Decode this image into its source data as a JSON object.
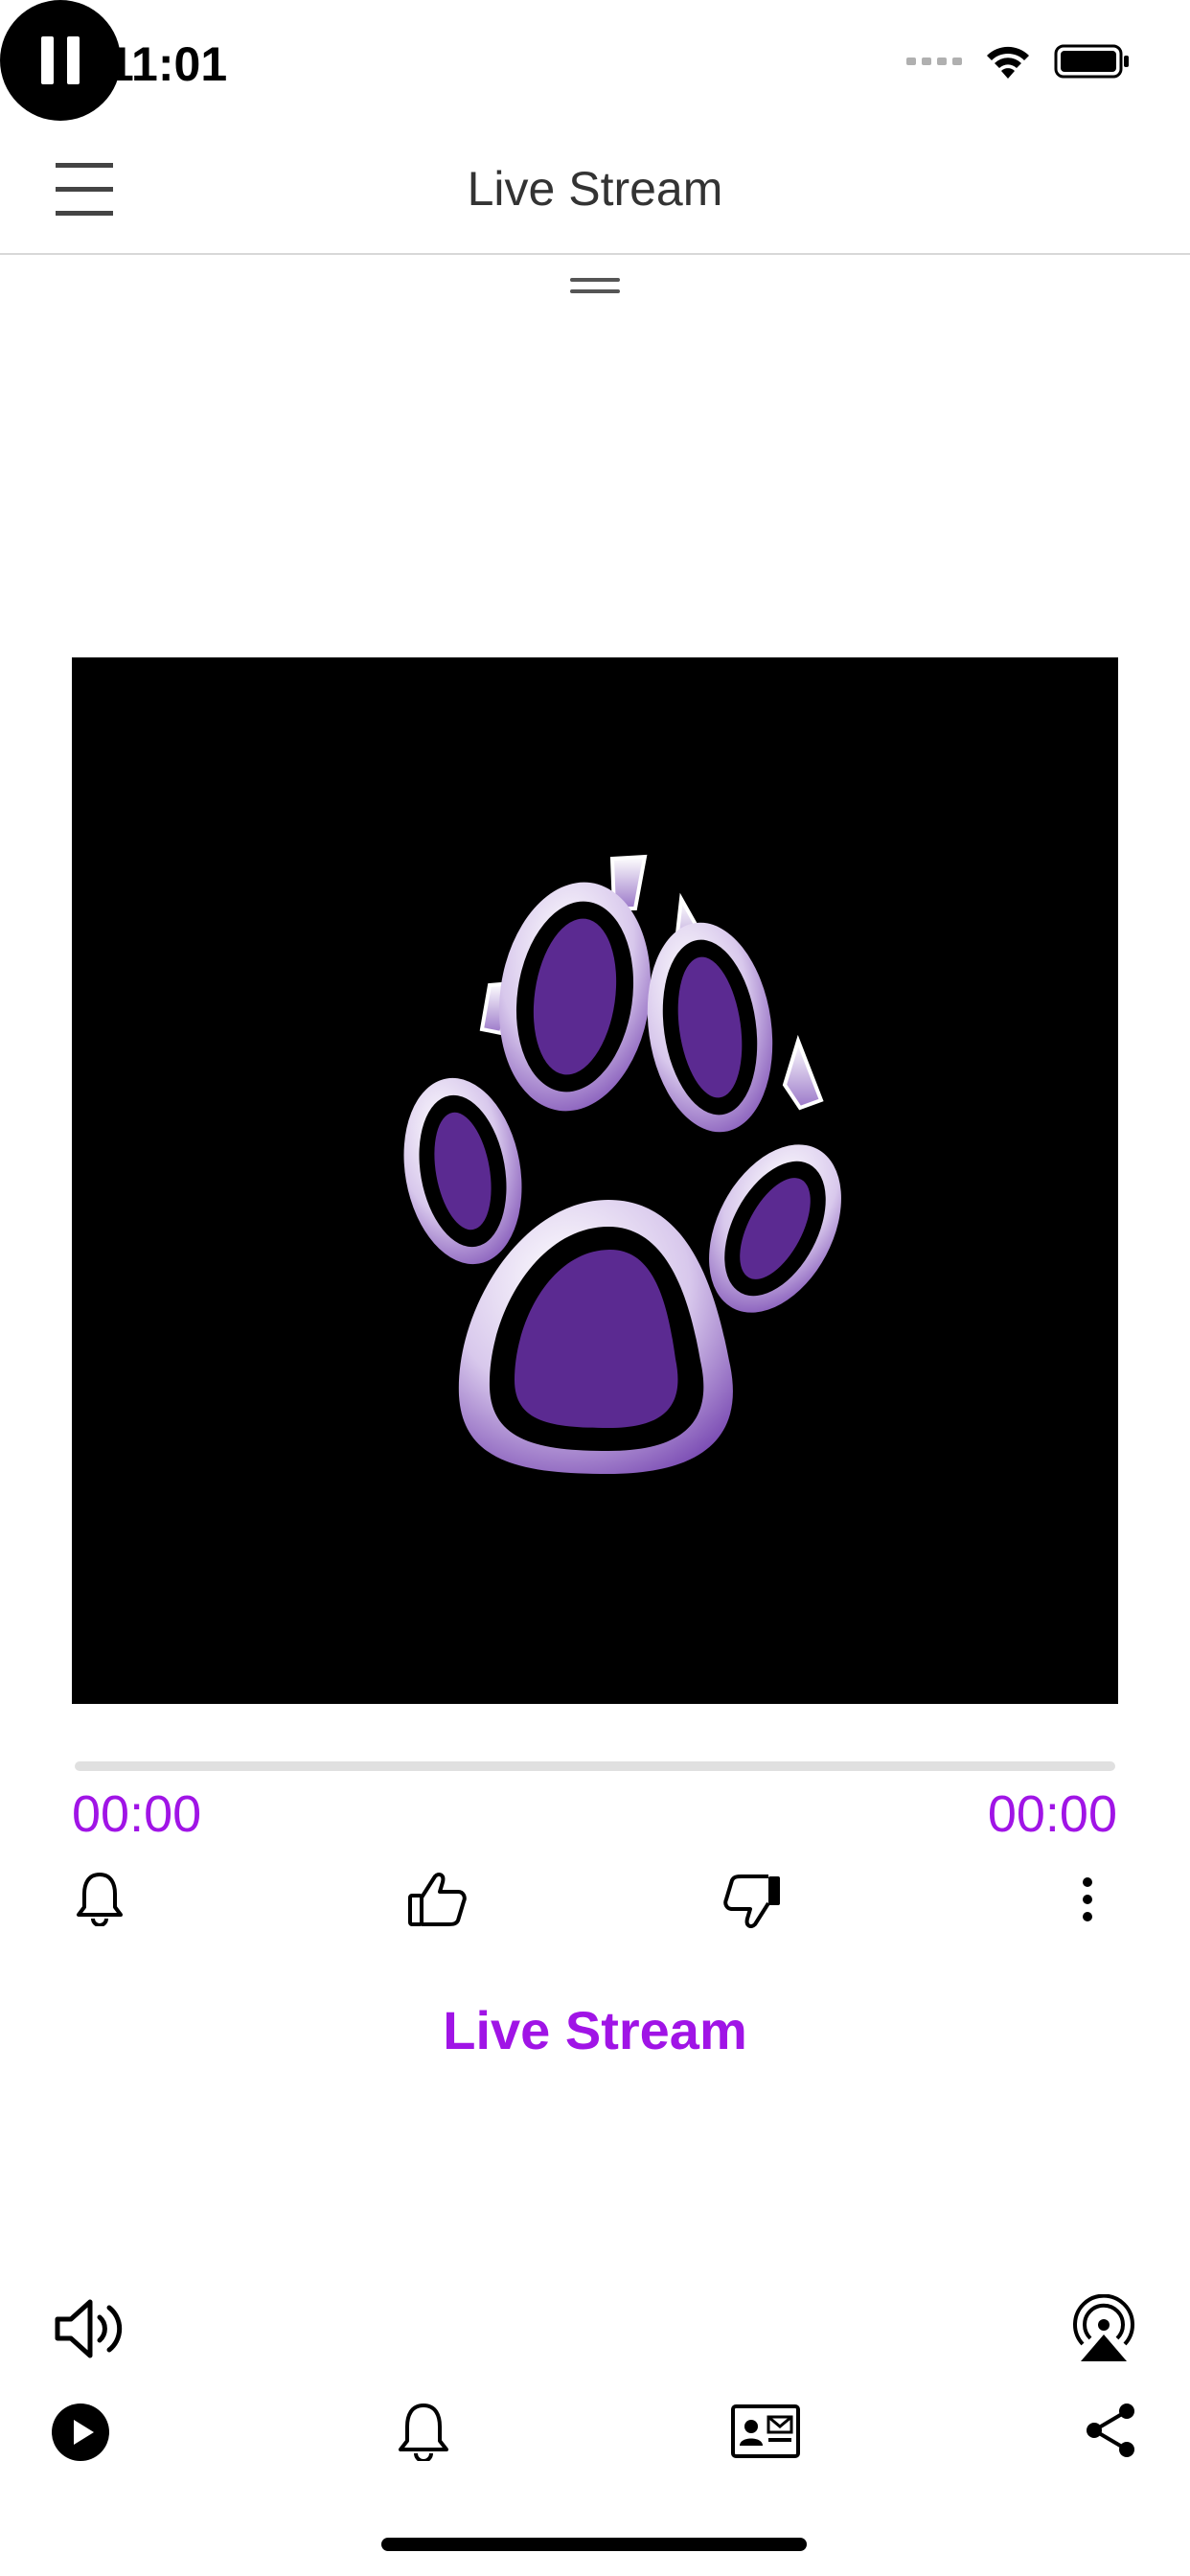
{
  "status_bar": {
    "time": "11:01"
  },
  "nav": {
    "title": "Live Stream"
  },
  "player": {
    "elapsed": "00:00",
    "total": "00:00",
    "progress": 0,
    "track_title": "Live Stream",
    "state": "playing"
  },
  "colors": {
    "accent": "#a014e6",
    "paw_purple": "#5b2a91"
  }
}
